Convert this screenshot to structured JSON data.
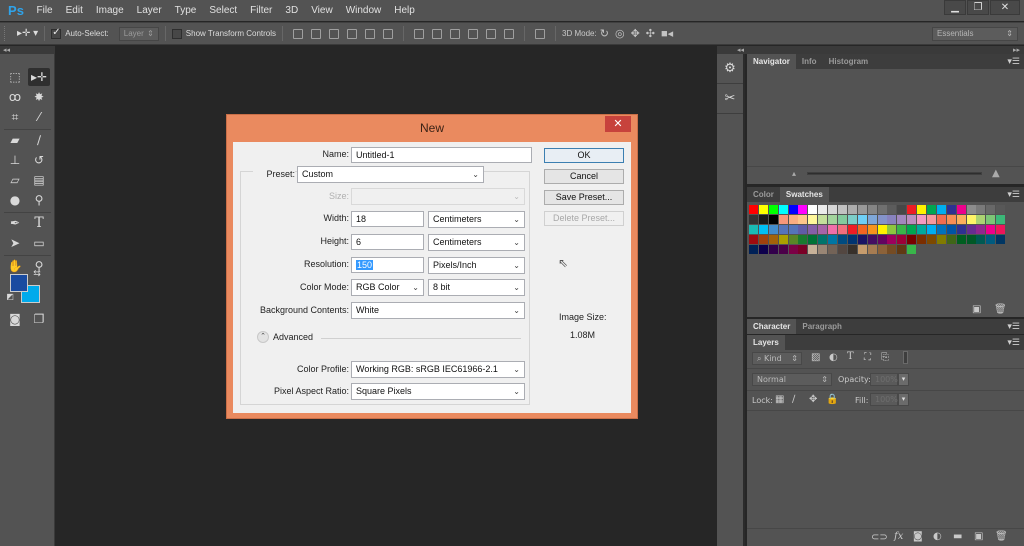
{
  "app": {
    "logo": "Ps",
    "menu": [
      "File",
      "Edit",
      "Image",
      "Layer",
      "Type",
      "Select",
      "Filter",
      "3D",
      "View",
      "Window",
      "Help"
    ],
    "window_controls": {
      "minimize": "▁",
      "restore": "❐",
      "close": "✕"
    }
  },
  "options_bar": {
    "tool_icon": "move-tool",
    "auto_select_label": "Auto-Select:",
    "auto_select_checked": true,
    "auto_select_target": "Layer",
    "show_transform_label": "Show Transform Controls",
    "show_transform_checked": false,
    "mode_3d_label": "3D Mode:",
    "workspace": "Essentials"
  },
  "toolbox": {
    "collapse_label": "◂◂",
    "tools": [
      {
        "name": "rectangular-marquee",
        "glyph": "⬚"
      },
      {
        "name": "move",
        "glyph": "▸✛",
        "active": true
      },
      {
        "name": "lasso",
        "glyph": "ꝏ"
      },
      {
        "name": "magic-wand",
        "glyph": "✸"
      },
      {
        "name": "crop",
        "glyph": "⌗"
      },
      {
        "name": "eyedropper",
        "glyph": "⁄"
      },
      {
        "name": "spot-healing",
        "glyph": "▰"
      },
      {
        "name": "brush",
        "glyph": "∕"
      },
      {
        "name": "clone-stamp",
        "glyph": "⊥"
      },
      {
        "name": "history-brush",
        "glyph": "↺"
      },
      {
        "name": "eraser",
        "glyph": "▱"
      },
      {
        "name": "gradient",
        "glyph": "▤"
      },
      {
        "name": "blur",
        "glyph": "💧"
      },
      {
        "name": "dodge",
        "glyph": "⚲"
      },
      {
        "name": "pen",
        "glyph": "✒"
      },
      {
        "name": "type",
        "glyph": "T"
      },
      {
        "name": "path-selection",
        "glyph": "➤"
      },
      {
        "name": "rectangle-shape",
        "glyph": "▭"
      },
      {
        "name": "hand",
        "glyph": "✋"
      },
      {
        "name": "zoom",
        "glyph": "⚲"
      }
    ],
    "foreground_color": "#1a4ba0",
    "background_color": "#00aaeb"
  },
  "dialog": {
    "title": "New",
    "close": "✕",
    "name_label": "Name:",
    "name_value": "Untitled-1",
    "preset_label": "Preset:",
    "preset_value": "Custom",
    "size_label": "Size:",
    "size_value": "",
    "width_label": "Width:",
    "width_value": "18",
    "width_unit": "Centimeters",
    "height_label": "Height:",
    "height_value": "6",
    "height_unit": "Centimeters",
    "resolution_label": "Resolution:",
    "resolution_value": "150",
    "resolution_unit": "Pixels/Inch",
    "color_mode_label": "Color Mode:",
    "color_mode_value": "RGB Color",
    "bit_depth": "8 bit",
    "background_label": "Background Contents:",
    "background_value": "White",
    "advanced_label": "Advanced",
    "color_profile_label": "Color Profile:",
    "color_profile_value": "Working RGB:  sRGB IEC61966-2.1",
    "pixel_aspect_label": "Pixel Aspect Ratio:",
    "pixel_aspect_value": "Square Pixels",
    "buttons": {
      "ok": "OK",
      "cancel": "Cancel",
      "save_preset": "Save Preset...",
      "delete_preset": "Delete Preset..."
    },
    "image_size_label": "Image Size:",
    "image_size_value": "1.08M",
    "caret": "⌄"
  },
  "panels": {
    "navigator_tabs": [
      "Navigator",
      "Info",
      "Histogram"
    ],
    "swatch_tabs": [
      "Color",
      "Swatches"
    ],
    "character_tabs": [
      "Character",
      "Paragraph"
    ],
    "layers_tabs": [
      "Layers"
    ],
    "layers": {
      "kind_label": "Kind",
      "blend_mode": "Normal",
      "opacity_label": "Opacity:",
      "opacity_value": "100%",
      "lock_label": "Lock:",
      "fill_label": "Fill:",
      "fill_value": "100%"
    },
    "menu_icon": "▾☰"
  },
  "swatches": [
    "#ff0000",
    "#ffff00",
    "#00ff00",
    "#00ffff",
    "#0000ff",
    "#ff00ff",
    "#ffffff",
    "#ebebeb",
    "#d6d6d6",
    "#c2c2c2",
    "#adadad",
    "#999999",
    "#858585",
    "#707070",
    "#5c5c5c",
    "#474747",
    "#ed1c24",
    "#fff200",
    "#00a651",
    "#00aeef",
    "#2e3192",
    "#ec008c",
    "#8c8c8c",
    "#7a7a7a",
    "#686868",
    "#585858",
    "#333333",
    "#1a1a1a",
    "#000000",
    "#f7977a",
    "#f9ad81",
    "#fdc68a",
    "#fff79a",
    "#c4df9b",
    "#a2d39c",
    "#82ca9d",
    "#7bcdc8",
    "#6ecff6",
    "#7ea7d8",
    "#8493ca",
    "#8882be",
    "#a187be",
    "#bc8dbf",
    "#f49ac2",
    "#f6989d",
    "#f26c4f",
    "#f68e55",
    "#fbaf5c",
    "#fff467",
    "#acd372",
    "#7cc576",
    "#3bb878",
    "#1abbb4",
    "#00bff3",
    "#438ccb",
    "#5674b9",
    "#5574b9",
    "#605ca8",
    "#855fa8",
    "#a763a8",
    "#f06ea9",
    "#f26d7d",
    "#ed1c24",
    "#f26522",
    "#f7941d",
    "#fff200",
    "#8dc63f",
    "#39b54a",
    "#00a651",
    "#00a99d",
    "#00aeef",
    "#0072bc",
    "#0054a6",
    "#2e3192",
    "#662d91",
    "#92278f",
    "#ec008c",
    "#ed145b",
    "#9e0b0f",
    "#a0410d",
    "#a36209",
    "#aba000",
    "#598527",
    "#1a7b30",
    "#007236",
    "#00746b",
    "#0076a3",
    "#004b80",
    "#003471",
    "#1b1464",
    "#440e62",
    "#630460",
    "#9e005d",
    "#9e0039",
    "#790000",
    "#7b2e00",
    "#7d4900",
    "#827b00",
    "#406618",
    "#005e20",
    "#005826",
    "#005952",
    "#005b7f",
    "#003663",
    "#002157",
    "#0d004c",
    "#32004b",
    "#4b0049",
    "#7b0046",
    "#7a0026",
    "#c7b299",
    "#998675",
    "#736357",
    "#534741",
    "#37302a",
    "#c69c6d",
    "#a67c52",
    "#8c6239",
    "#754c24",
    "#603913",
    "#39b54a"
  ]
}
